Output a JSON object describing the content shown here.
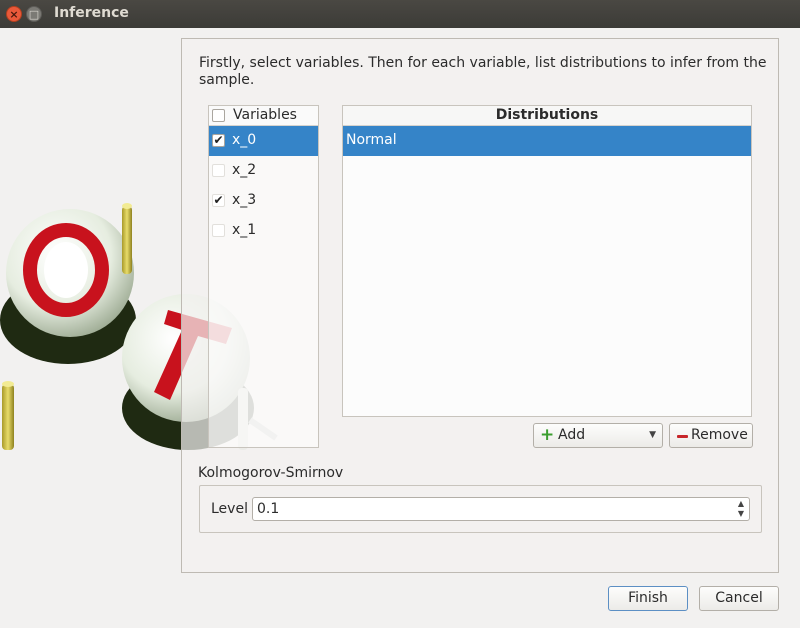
{
  "window": {
    "title": "Inference",
    "close_glyph": "×",
    "maximize_glyph": "□"
  },
  "intro": "Firstly, select variables. Then for each variable, list distributions to infer from the sample.",
  "variables": {
    "header": "Variables",
    "items": [
      {
        "label": "x_0",
        "checked": true,
        "selected": true,
        "mark": "✔"
      },
      {
        "label": "x_2",
        "checked": false,
        "selected": false,
        "mark": ""
      },
      {
        "label": "x_3",
        "checked": true,
        "selected": false,
        "mark": "✔"
      },
      {
        "label": "x_1",
        "checked": false,
        "selected": false,
        "mark": ""
      }
    ]
  },
  "distributions": {
    "header": "Distributions",
    "items": [
      "Normal"
    ]
  },
  "buttons": {
    "add": "Add",
    "add_icon": "plus-icon",
    "remove": "Remove",
    "remove_icon": "minus-icon",
    "finish": "Finish",
    "cancel": "Cancel"
  },
  "ks": {
    "title": "Kolmogorov-Smirnov",
    "level_label": "Level",
    "level_value": "0.1"
  },
  "colors": {
    "selection": "#3584c8",
    "titlebar": "#3c3b37",
    "close": "#e9593a"
  }
}
